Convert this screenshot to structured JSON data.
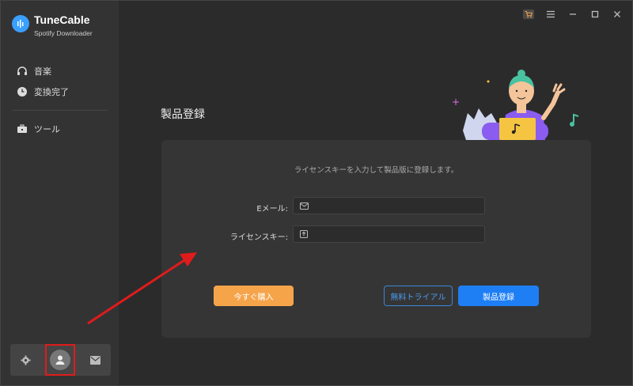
{
  "app": {
    "name": "TuneCable",
    "subtitle": "Spotify Downloader"
  },
  "sidebar": {
    "items": [
      {
        "label": "音楽",
        "icon": "headphones-icon"
      },
      {
        "label": "変換完了",
        "icon": "clock-icon"
      },
      {
        "label": "ツール",
        "icon": "toolbox-icon"
      }
    ]
  },
  "main": {
    "title": "製品登録",
    "hint": "ライセンスキーを入力して製品版に登録します。",
    "email_label": "Eメール:",
    "email_value": "",
    "license_label": "ライセンスキー:",
    "license_value": "",
    "buy_label": "今すぐ購入",
    "trial_label": "無料トライアル",
    "register_label": "製品登録"
  },
  "colors": {
    "accent_orange": "#f5a44a",
    "accent_blue": "#1e7ff5",
    "highlight_red": "#e01b1b"
  }
}
